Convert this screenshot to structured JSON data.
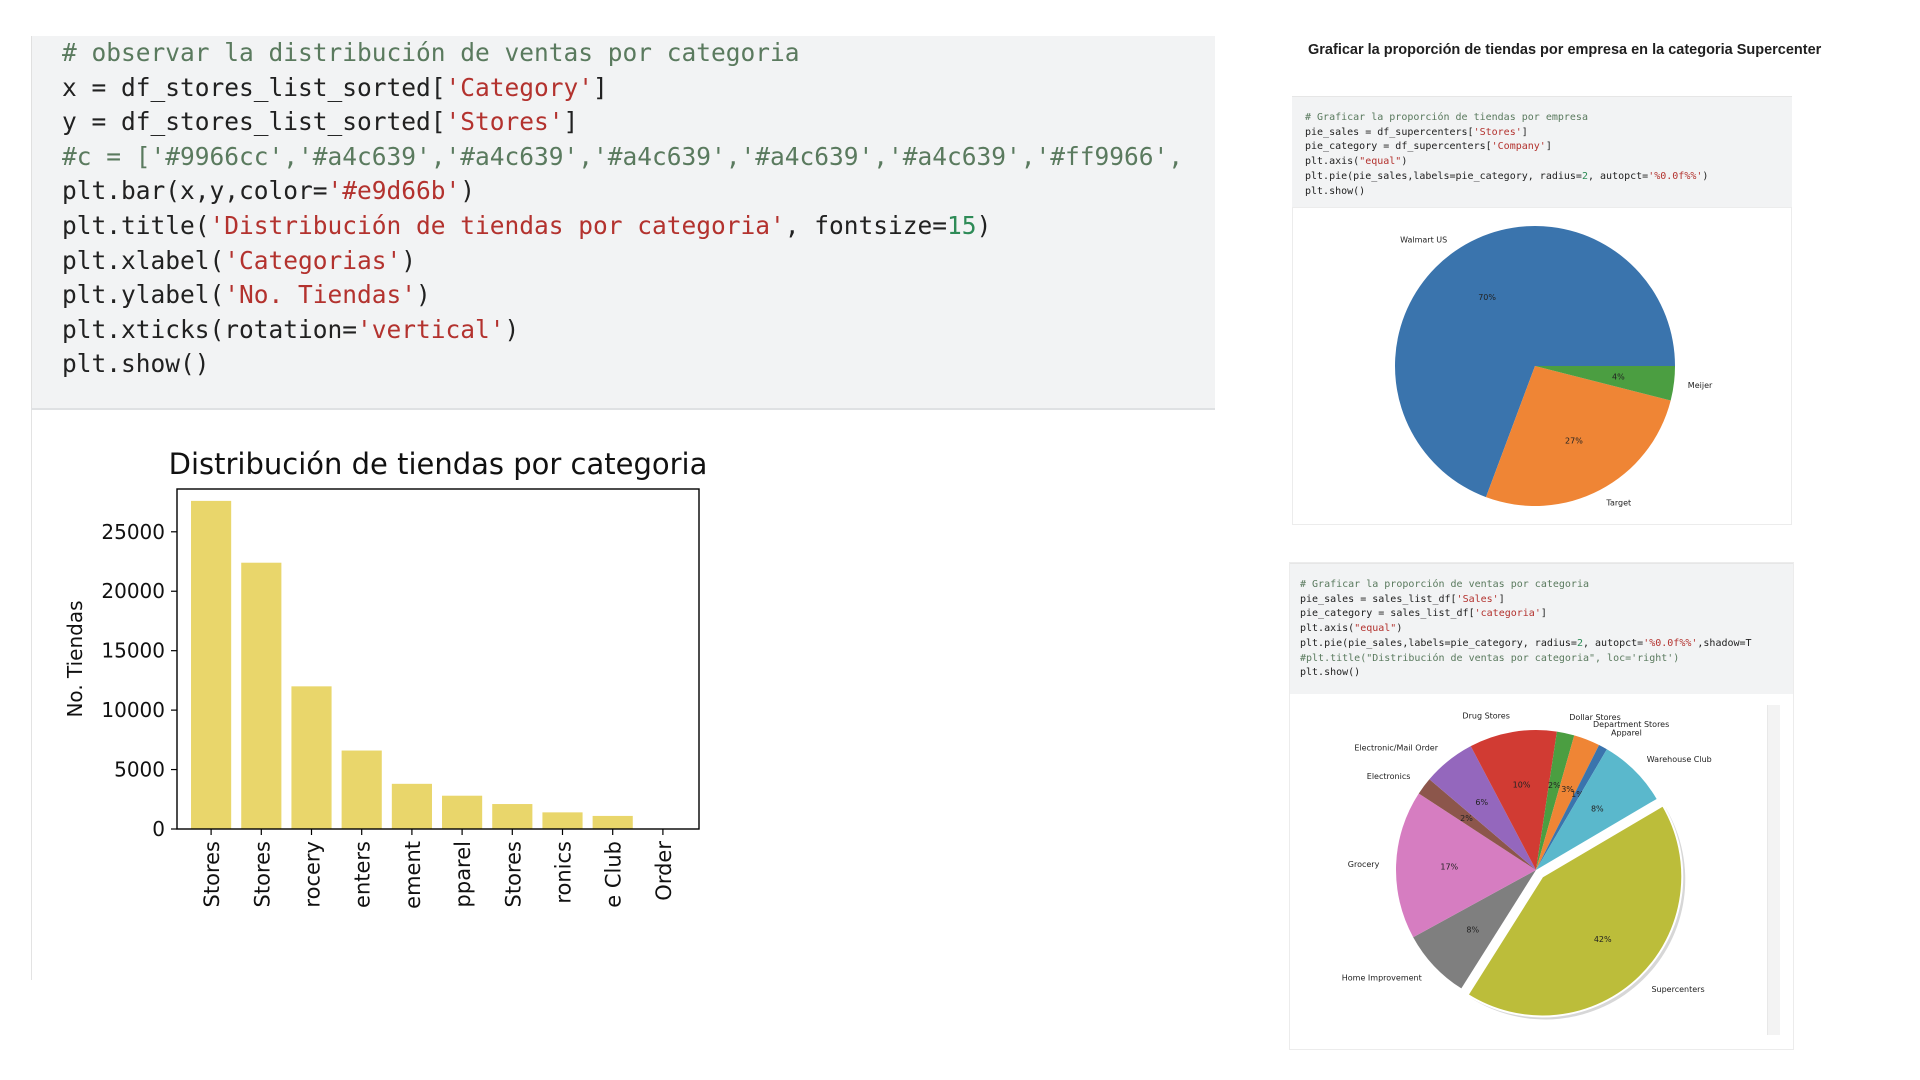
{
  "main_cell": {
    "code_lines": [
      [
        {
          "t": "# observar la distribución de ventas por categoria",
          "c": "c"
        }
      ],
      [
        {
          "t": "x = df_stores_list_sorted[",
          "c": "p"
        },
        {
          "t": "'Category'",
          "c": "s"
        },
        {
          "t": "]",
          "c": "p"
        }
      ],
      [
        {
          "t": "y = df_stores_list_sorted[",
          "c": "p"
        },
        {
          "t": "'Stores'",
          "c": "s"
        },
        {
          "t": "]",
          "c": "p"
        }
      ],
      [
        {
          "t": "#c = ['#9966cc','#a4c639','#a4c639','#a4c639','#a4c639','#a4c639','#ff9966',",
          "c": "c"
        }
      ],
      [
        {
          "t": "plt.bar(x,y,color=",
          "c": "p"
        },
        {
          "t": "'#e9d66b'",
          "c": "s"
        },
        {
          "t": ")",
          "c": "p"
        }
      ],
      [
        {
          "t": "plt.title(",
          "c": "p"
        },
        {
          "t": "'Distribución de tiendas por categoria'",
          "c": "s"
        },
        {
          "t": ", fontsize=",
          "c": "p"
        },
        {
          "t": "15",
          "c": "n"
        },
        {
          "t": ")",
          "c": "p"
        }
      ],
      [
        {
          "t": "plt.xlabel(",
          "c": "p"
        },
        {
          "t": "'Categorias'",
          "c": "s"
        },
        {
          "t": ")",
          "c": "p"
        }
      ],
      [
        {
          "t": "plt.ylabel(",
          "c": "p"
        },
        {
          "t": "'No. Tiendas'",
          "c": "s"
        },
        {
          "t": ")",
          "c": "p"
        }
      ],
      [
        {
          "t": "plt.xticks(rotation=",
          "c": "p"
        },
        {
          "t": "'vertical'",
          "c": "s"
        },
        {
          "t": ")",
          "c": "p"
        }
      ],
      [
        {
          "t": "plt.show()",
          "c": "p"
        }
      ]
    ]
  },
  "right_heading": "Graficar la proporción de tiendas por empresa en la categoria Supercenter",
  "pie1_cell": {
    "code_lines": [
      [
        {
          "t": "# Graficar la proporción de tiendas por empresa",
          "c": "c"
        }
      ],
      [
        {
          "t": "pie_sales = df_supercenters[",
          "c": "p"
        },
        {
          "t": "'Stores'",
          "c": "s"
        },
        {
          "t": "]",
          "c": "p"
        }
      ],
      [
        {
          "t": "pie_category = df_supercenters[",
          "c": "p"
        },
        {
          "t": "'Company'",
          "c": "s"
        },
        {
          "t": "]",
          "c": "p"
        }
      ],
      [
        {
          "t": "plt.axis(",
          "c": "p"
        },
        {
          "t": "\"equal\"",
          "c": "s"
        },
        {
          "t": ")",
          "c": "p"
        }
      ],
      [
        {
          "t": "plt.pie(pie_sales,labels=pie_category, radius=",
          "c": "p"
        },
        {
          "t": "2",
          "c": "n"
        },
        {
          "t": ", autopct=",
          "c": "p"
        },
        {
          "t": "'%0.0f%%'",
          "c": "s"
        },
        {
          "t": ")",
          "c": "p"
        }
      ],
      [
        {
          "t": "plt.show()",
          "c": "p"
        }
      ]
    ]
  },
  "pie2_cell": {
    "code_lines": [
      [
        {
          "t": "# Graficar la proporción de ventas por categoria",
          "c": "c"
        }
      ],
      [
        {
          "t": "pie_sales = sales_list_df[",
          "c": "p"
        },
        {
          "t": "'Sales'",
          "c": "s"
        },
        {
          "t": "]",
          "c": "p"
        }
      ],
      [
        {
          "t": "pie_category = sales_list_df[",
          "c": "p"
        },
        {
          "t": "'categoria'",
          "c": "s"
        },
        {
          "t": "]",
          "c": "p"
        }
      ],
      [
        {
          "t": "plt.axis(",
          "c": "p"
        },
        {
          "t": "\"equal\"",
          "c": "s"
        },
        {
          "t": ")",
          "c": "p"
        }
      ],
      [
        {
          "t": "plt.pie(pie_sales,labels=pie_category, radius=",
          "c": "p"
        },
        {
          "t": "2",
          "c": "n"
        },
        {
          "t": ", autopct=",
          "c": "p"
        },
        {
          "t": "'%0.0f%%'",
          "c": "s"
        },
        {
          "t": ",shadow=T",
          "c": "p"
        }
      ],
      [
        {
          "t": "#plt.title(\"Distribución de ventas por categoria\", loc='right')",
          "c": "c"
        }
      ],
      [
        {
          "t": "plt.show()",
          "c": "p"
        }
      ]
    ]
  },
  "chart_data": [
    {
      "type": "bar",
      "title": "Distribución de tiendas por categoria",
      "xlabel": "",
      "ylabel": "No. Tiendas",
      "categories": [
        "Stores",
        "Stores",
        "rocery",
        "enters",
        "ement",
        "pparel",
        "Stores",
        "ronics",
        "e Club",
        "Order"
      ],
      "values": [
        27600,
        22400,
        12000,
        6600,
        3800,
        2800,
        2100,
        1400,
        1100,
        0
      ],
      "color": "#e9d66b",
      "ylim": [
        0,
        28600
      ],
      "yticks": [
        0,
        5000,
        10000,
        15000,
        20000,
        25000
      ],
      "grid": false
    },
    {
      "type": "pie",
      "labels": [
        "Walmart US",
        "Target",
        "Meijer"
      ],
      "values": [
        70,
        27,
        4
      ],
      "percent_labels": [
        "70%",
        "27%",
        "4%"
      ],
      "colors": [
        "#3a74ad",
        "#ef8535",
        "#4b9e41"
      ]
    },
    {
      "type": "pie",
      "labels": [
        "Supercenters",
        "Home Improvement",
        "Grocery",
        "Electronics",
        "Electronic/Mail Order",
        "Drug Stores",
        "Dollar Stores",
        "Department Stores",
        "Apparel",
        "Warehouse Club"
      ],
      "values": [
        42,
        8,
        17,
        2,
        6,
        10,
        2,
        3,
        1,
        8
      ],
      "percent_labels": [
        "42%",
        "8%",
        "17%",
        "2%",
        "6%",
        "10%",
        "2%",
        "3%",
        "1%",
        "8%"
      ],
      "colors": [
        "#bcbd3a",
        "#7f7f7f",
        "#d67dc1",
        "#8c564b",
        "#9467bd",
        "#d13b33",
        "#4b9e41",
        "#ef8535",
        "#3a74ad",
        "#5ab8cc"
      ]
    }
  ]
}
